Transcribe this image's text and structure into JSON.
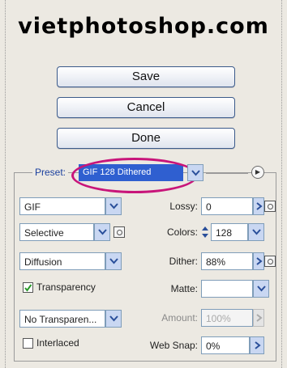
{
  "watermark": "vietphotoshop.com",
  "buttons": {
    "save": "Save",
    "cancel": "Cancel",
    "done": "Done"
  },
  "preset": {
    "label": "Preset:",
    "value": "GIF 128 Dithered"
  },
  "format": {
    "value": "GIF"
  },
  "reduction": {
    "value": "Selective"
  },
  "dither_algorithm": {
    "value": "Diffusion"
  },
  "transparency": {
    "label": "Transparency",
    "checked": true
  },
  "transparency_dither": {
    "value": "No Transparen..."
  },
  "interlaced": {
    "label": "Interlaced",
    "checked": false
  },
  "lossy": {
    "label": "Lossy:",
    "value": "0"
  },
  "colors": {
    "label": "Colors:",
    "value": "128"
  },
  "dither": {
    "label": "Dither:",
    "value": "88%"
  },
  "matte": {
    "label": "Matte:",
    "value": ""
  },
  "amount": {
    "label": "Amount:",
    "value": "100%"
  },
  "web_snap": {
    "label": "Web Snap:",
    "value": "0%"
  },
  "colors_theme": {
    "accent": "#2f5fd0",
    "highlight": "#c8157a",
    "border": "#7f9db9"
  }
}
